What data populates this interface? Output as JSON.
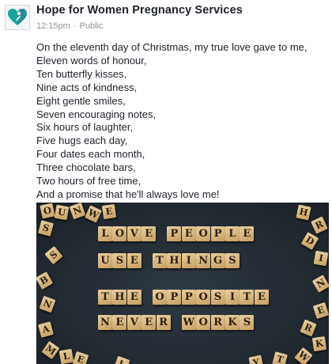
{
  "post": {
    "page_name": "Hope for Women Pregnancy Services",
    "time": "12:15pm",
    "separator": "·",
    "audience": "Public",
    "logo_icon": "heart-logo-icon",
    "brand_colors": {
      "heart_left": "#1aa3a3",
      "heart_right": "#2a8a9c",
      "figure": "#ffffff"
    },
    "lines": [
      "On the eleventh day of Christmas, my true love gave to me,",
      "Eleven words of honour,",
      "Ten butterfly kisses,",
      "Nine acts of kindness,",
      "Eight gentle smiles,",
      "Seven encouraging notes,",
      "Six hours of laughter,",
      "Five hugs each day,",
      "Four dates each month,",
      "Three chocolate bars,",
      "Two hours of free time,",
      "And a promise that he'll always love me!"
    ],
    "photo": {
      "board_color": "#232b33",
      "rows": [
        "LOVE PEOPLE",
        "USE THINGS",
        "THE OPPOSITE",
        "NEVER WORKS"
      ],
      "scattered": [
        "O",
        "U",
        "N",
        "W",
        "E",
        "S",
        "B",
        "N",
        "A",
        "M",
        "L",
        "E",
        "H",
        "R",
        "D",
        "E",
        "R",
        "K",
        "W",
        "I",
        "S",
        "T",
        "Y",
        "L",
        "N"
      ]
    }
  }
}
